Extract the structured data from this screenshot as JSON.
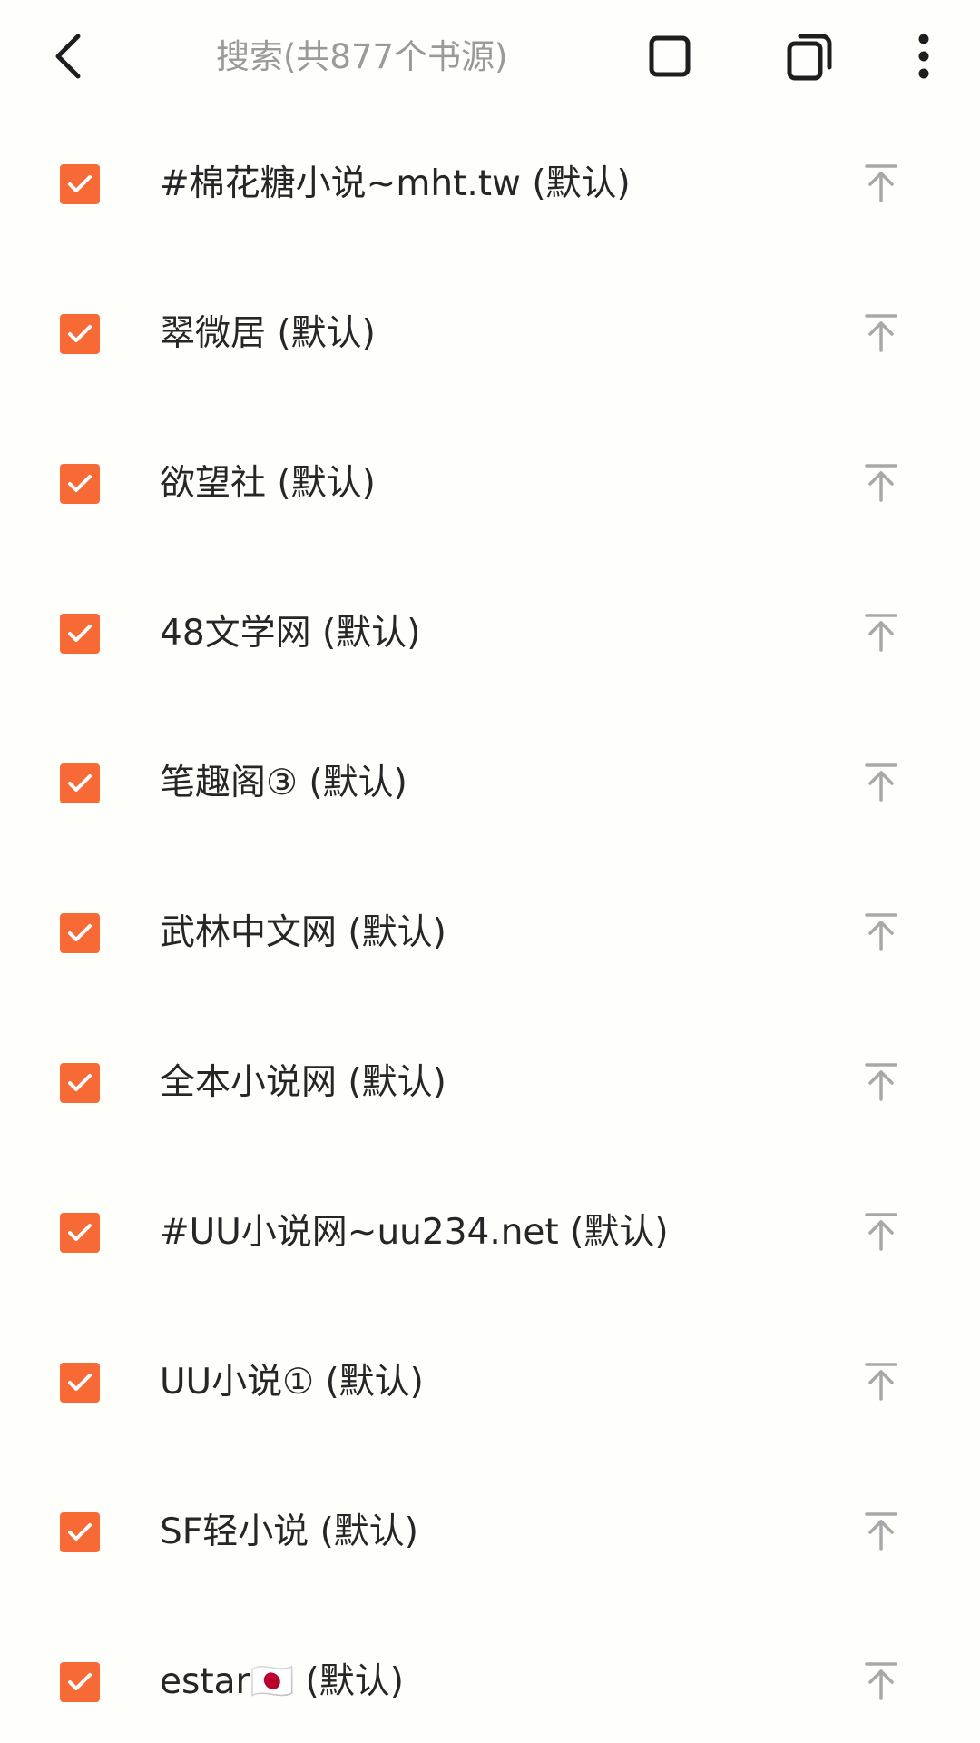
{
  "topbar": {
    "search_placeholder": "搜索(共877个书源)",
    "back_icon": "back-arrow-icon",
    "select_all_icon": "square-outline-icon",
    "revert_icon": "copy-stack-icon",
    "more_icon": "more-vertical-icon"
  },
  "colors": {
    "accent": "#F86A35",
    "icon_dark": "#1E1E1E",
    "icon_muted": "#A8A8A8",
    "text": "#262626",
    "placeholder": "#9A9A9A"
  },
  "sources": [
    {
      "label": "#棉花糖小说~mht.tw (默认)",
      "checked": true
    },
    {
      "label": "翠微居 (默认)",
      "checked": true
    },
    {
      "label": "欲望社 (默认)",
      "checked": true
    },
    {
      "label": "48文学网 (默认)",
      "checked": true
    },
    {
      "label": "笔趣阁③ (默认)",
      "checked": true
    },
    {
      "label": "武林中文网 (默认)",
      "checked": true
    },
    {
      "label": "全本小说网 (默认)",
      "checked": true
    },
    {
      "label": "#UU小说网~uu234.net (默认)",
      "checked": true
    },
    {
      "label": "UU小说① (默认)",
      "checked": true
    },
    {
      "label": "SF轻小说 (默认)",
      "checked": true
    },
    {
      "label": "estar🇯🇵 (默认)",
      "checked": true
    }
  ]
}
